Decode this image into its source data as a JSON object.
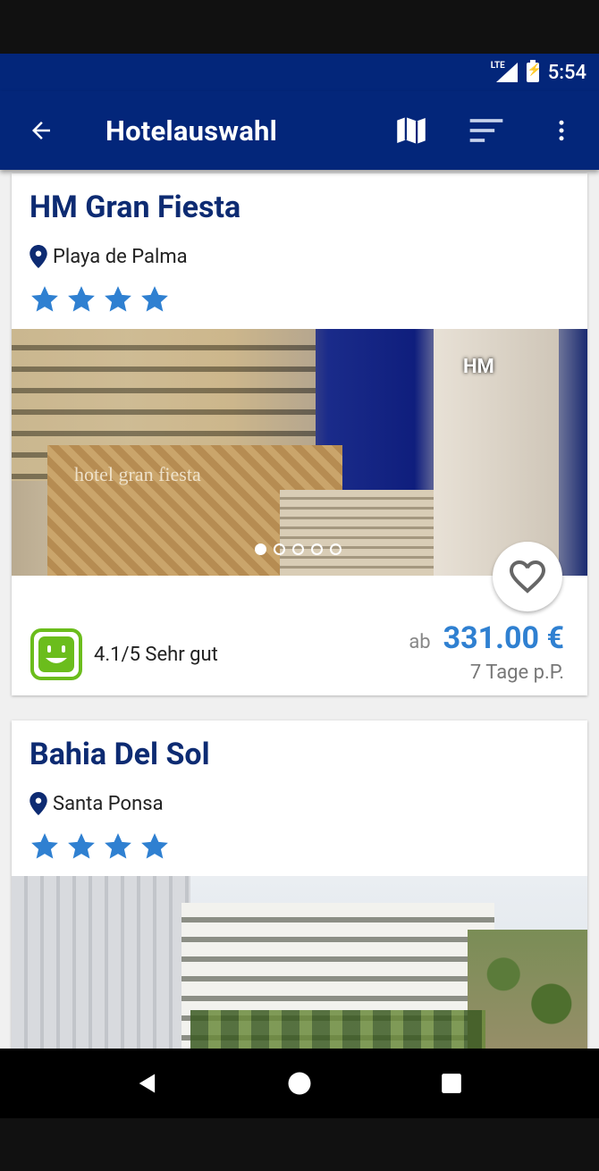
{
  "status_bar": {
    "network": "LTE",
    "time": "5:54"
  },
  "app_bar": {
    "title": "Hotelauswahl",
    "back_icon": "arrow-back-icon",
    "actions": [
      "map-icon",
      "sort-icon",
      "more-vert-icon"
    ]
  },
  "hotels": [
    {
      "name": "HM Gran Fiesta",
      "location": "Playa de Palma",
      "stars": 4,
      "photo_caption": "hotel gran fiesta",
      "photo_logo": "HM",
      "carousel": {
        "count": 5,
        "active": 0
      },
      "rating": "4.1/5 Sehr gut",
      "price_prefix": "ab",
      "price": "331.00 €",
      "price_sub": "7 Tage p.P."
    },
    {
      "name": "Bahia Del Sol",
      "location": "Santa Ponsa",
      "stars": 4
    }
  ],
  "colors": {
    "primary": "#03267a",
    "hotel_name": "#0d2b72",
    "star": "#2f80d1",
    "price": "#2f80d1",
    "rating_smiley": "#6bbd1c"
  }
}
